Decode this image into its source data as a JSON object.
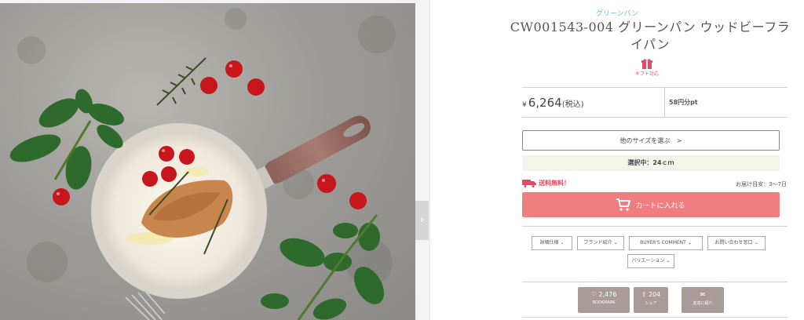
{
  "product": {
    "brand": "グリーンパン",
    "title": "CW001543-004 グリーンパン ウッドビーフライパン",
    "gift_label": "ギフト対応",
    "image_alt": "フライパン",
    "price": {
      "currency": "¥",
      "amount": "6,264",
      "tax_note": "(税込)",
      "points": "58円分pt"
    }
  },
  "purchase": {
    "size_button": "他のサイズを選ぶ",
    "size_chevron": ">",
    "selected_label": "選択中：24ｃｍ",
    "shipping_label": "送料無料！",
    "delivery_label": "お届け目安：3～7日",
    "cart_button": "カートに入れる"
  },
  "tabs": [
    {
      "label": "詳細仕様"
    },
    {
      "label": "ブランド紹介"
    },
    {
      "label": "BUYER'S COMMENT"
    },
    {
      "label": "お問い合わせ窓口"
    },
    {
      "label": "バリエーション"
    }
  ],
  "actions": {
    "like": {
      "count": "2,476",
      "label": "BOOKMARK"
    },
    "share": {
      "count": "204",
      "label": "シェア"
    },
    "mail": {
      "icon_text": "✉",
      "label": "友達に紹介"
    }
  },
  "icons": {
    "gallery_next": "›",
    "tab_chevron": "⌄"
  },
  "colors": {
    "brand": "#6cc0cc",
    "accent_pink": "#e34a67",
    "cart": "#f07d7f",
    "action": "#a99b98"
  }
}
